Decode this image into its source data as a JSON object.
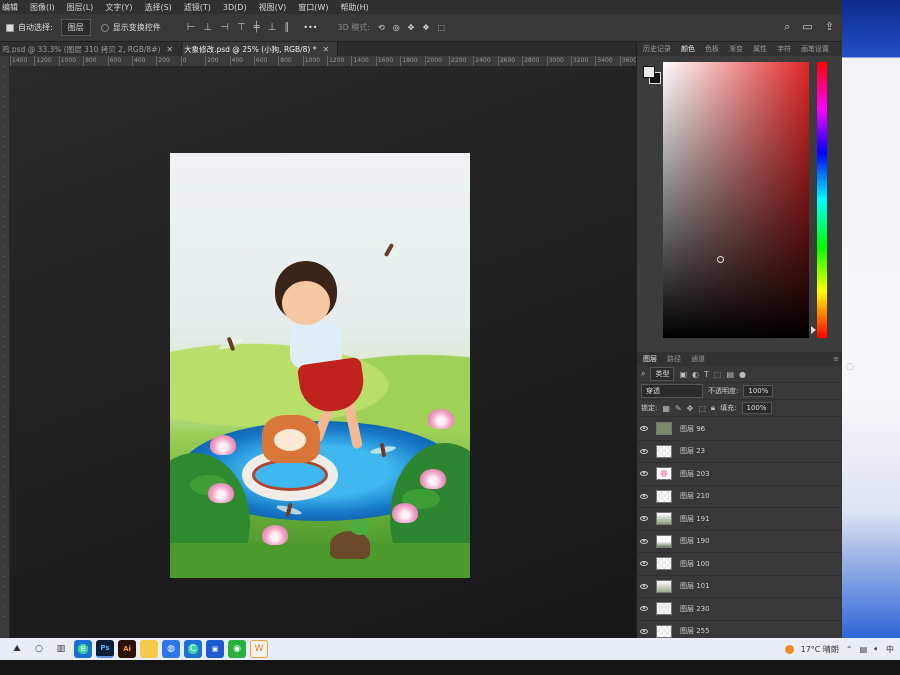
{
  "menu": [
    "编辑",
    "图像(I)",
    "图层(L)",
    "文字(Y)",
    "选择(S)",
    "滤镜(T)",
    "3D(D)",
    "视图(V)",
    "窗口(W)",
    "帮助(H)"
  ],
  "options": {
    "auto_select_label": "自动选择:",
    "auto_select_value": "图层",
    "show_transform_label": "显示变换控件",
    "mode_3d_label": "3D 模式:",
    "more_label": "•••"
  },
  "doc_tabs": [
    {
      "label": "鸡.psd @ 33.3% (图层 310 拷贝 2, RGB/8#)",
      "active": false
    },
    {
      "label": "大象修改.psd @ 25% (小狗, RGB/8) *",
      "active": true
    }
  ],
  "ruler_ticks": [
    "1400",
    "1200",
    "1000",
    "800",
    "600",
    "400",
    "200",
    "0",
    "200",
    "400",
    "600",
    "800",
    "1000",
    "1200",
    "1400",
    "1600",
    "1800",
    "2000",
    "2200",
    "2400",
    "2600",
    "2800",
    "3000",
    "3200",
    "3400",
    "3600"
  ],
  "color_panel": {
    "tabs": [
      "历史记录",
      "颜色",
      "色板",
      "渐变",
      "属性",
      "字符",
      "画笔设置"
    ],
    "active_tab": "颜色"
  },
  "layers_panel": {
    "tabs": [
      "图层",
      "路径",
      "通道"
    ],
    "active_tab": "图层",
    "filter_label": "类型",
    "blend_mode": "穿透",
    "opacity_label": "不透明度:",
    "opacity_value": "100%",
    "lock_label": "锁定:",
    "fill_label": "填充:",
    "fill_value": "100%",
    "layers": [
      "图层 96",
      "图层 23",
      "图层 203",
      "图层 210",
      "图层 191",
      "图层 190",
      "图层 100",
      "图层 101",
      "图层 230",
      "图层 255"
    ]
  },
  "taskbar": {
    "apps": [
      "Ps",
      "Ai",
      "folder",
      "browser",
      "C",
      "app",
      "wechat",
      "W"
    ],
    "weather": "17°C 晴朗",
    "ime": "中"
  }
}
